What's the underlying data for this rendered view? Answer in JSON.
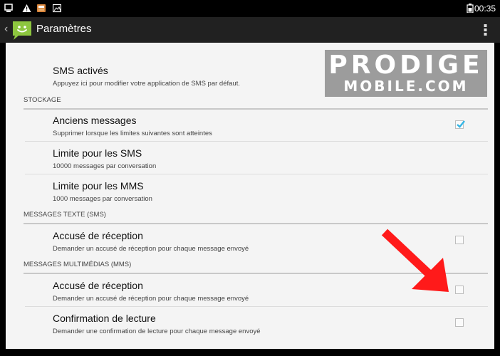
{
  "status_bar": {
    "time": "00:35",
    "icons": [
      "screen-icon",
      "warning-icon",
      "app-icon",
      "image-icon",
      "battery-icon"
    ]
  },
  "action_bar": {
    "title": "Paramètres",
    "icons": [
      "back-chevron-icon",
      "messaging-app-icon",
      "overflow-menu-icon"
    ]
  },
  "preferences": {
    "sms_enabled": {
      "title": "SMS activés",
      "summary": "Appuyez ici pour modifier votre application de SMS par défaut."
    },
    "storage_category": "STOCKAGE",
    "old_messages": {
      "title": "Anciens messages",
      "summary": "Supprimer lorsque les limites suivantes sont atteintes",
      "checked": true
    },
    "sms_limit": {
      "title": "Limite pour les SMS",
      "summary": "10000 messages par conversation"
    },
    "mms_limit": {
      "title": "Limite pour les MMS",
      "summary": "1000 messages par conversation"
    },
    "sms_category": "MESSAGES TEXTE (SMS)",
    "sms_delivery": {
      "title": "Accusé de réception",
      "summary": "Demander un accusé de réception pour chaque message envoyé",
      "checked": false
    },
    "mms_category": "MESSAGES MULTIMÉDIAS (MMS)",
    "mms_delivery": {
      "title": "Accusé de réception",
      "summary": "Demander un accusé de réception pour chaque message envoyé",
      "checked": false
    },
    "read_report": {
      "title": "Confirmation de lecture",
      "summary": "Demander une confirmation de lecture pour chaque message envoyé",
      "checked": false
    }
  },
  "watermark": {
    "line1": "PRODIGE",
    "line2": "MOBILE.COM"
  },
  "colors": {
    "accent": "#33b5e5",
    "app_icon": "#8dc63f",
    "arrow": "#ff1a1a"
  }
}
